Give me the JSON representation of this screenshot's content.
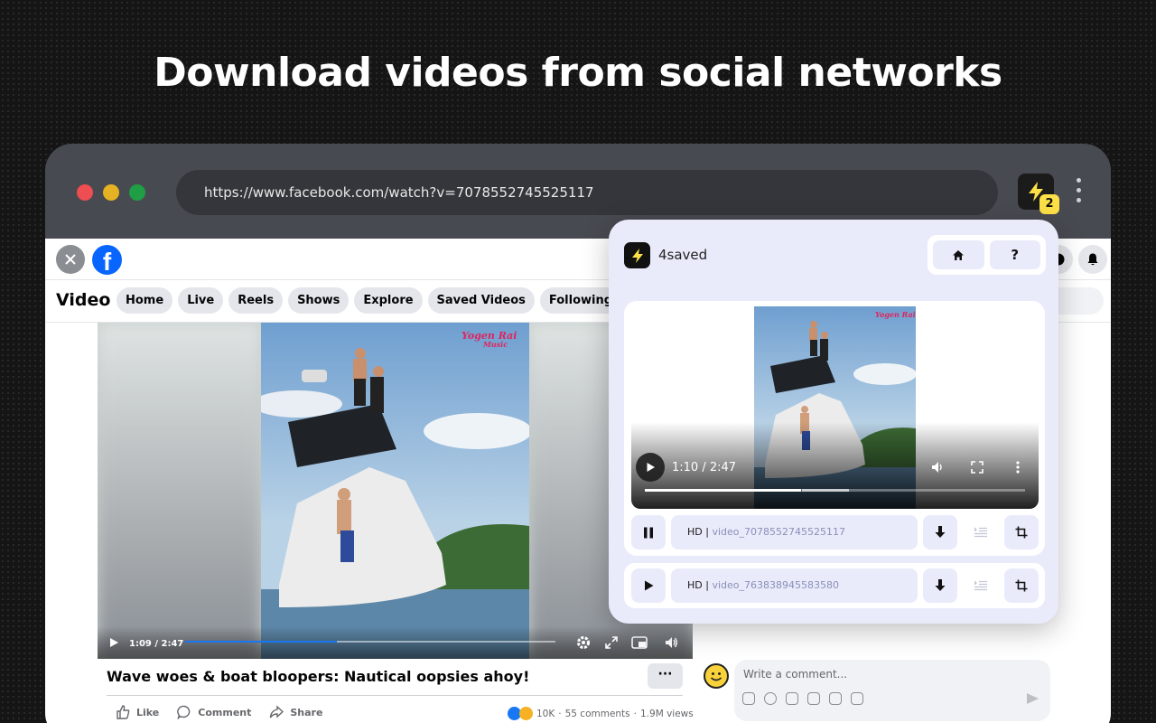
{
  "headline": "Download videos from social networks",
  "browser": {
    "url": "https://www.facebook.com/watch?v=7078552745525117",
    "extension_badge": "2"
  },
  "facebook": {
    "nav_title": "Video",
    "nav_pills": [
      "Home",
      "Live",
      "Reels",
      "Shows",
      "Explore",
      "Saved Videos",
      "Following"
    ],
    "player": {
      "time": "1:09 / 2:47",
      "progress": 0.41,
      "watermark_top": "Yogen Rai",
      "watermark_bottom": "Music"
    },
    "post": {
      "title": "Wave woes & boat bloopers: Nautical oopsies ahoy!",
      "more": "···",
      "actions": [
        "Like",
        "Comment",
        "Share"
      ],
      "reactions_count": "10K",
      "comments": "55 comments",
      "views": "1.9M views"
    },
    "comment_placeholder": "Write a comment..."
  },
  "popup": {
    "app_name": "4saved",
    "nav": {
      "home_icon": "home-icon",
      "help_label": "?"
    },
    "preview": {
      "time": "1:10 / 2:47",
      "progress": 0.41
    },
    "videos": [
      {
        "quality": "HD |",
        "filename": "video_7078552745525117",
        "state": "pause"
      },
      {
        "quality": "HD |",
        "filename": "video_763838945583580",
        "state": "play"
      }
    ]
  },
  "colors": {
    "accent_yellow": "#fde047",
    "popup_bg": "#e9ebfb",
    "fb_blue": "#0866ff"
  }
}
